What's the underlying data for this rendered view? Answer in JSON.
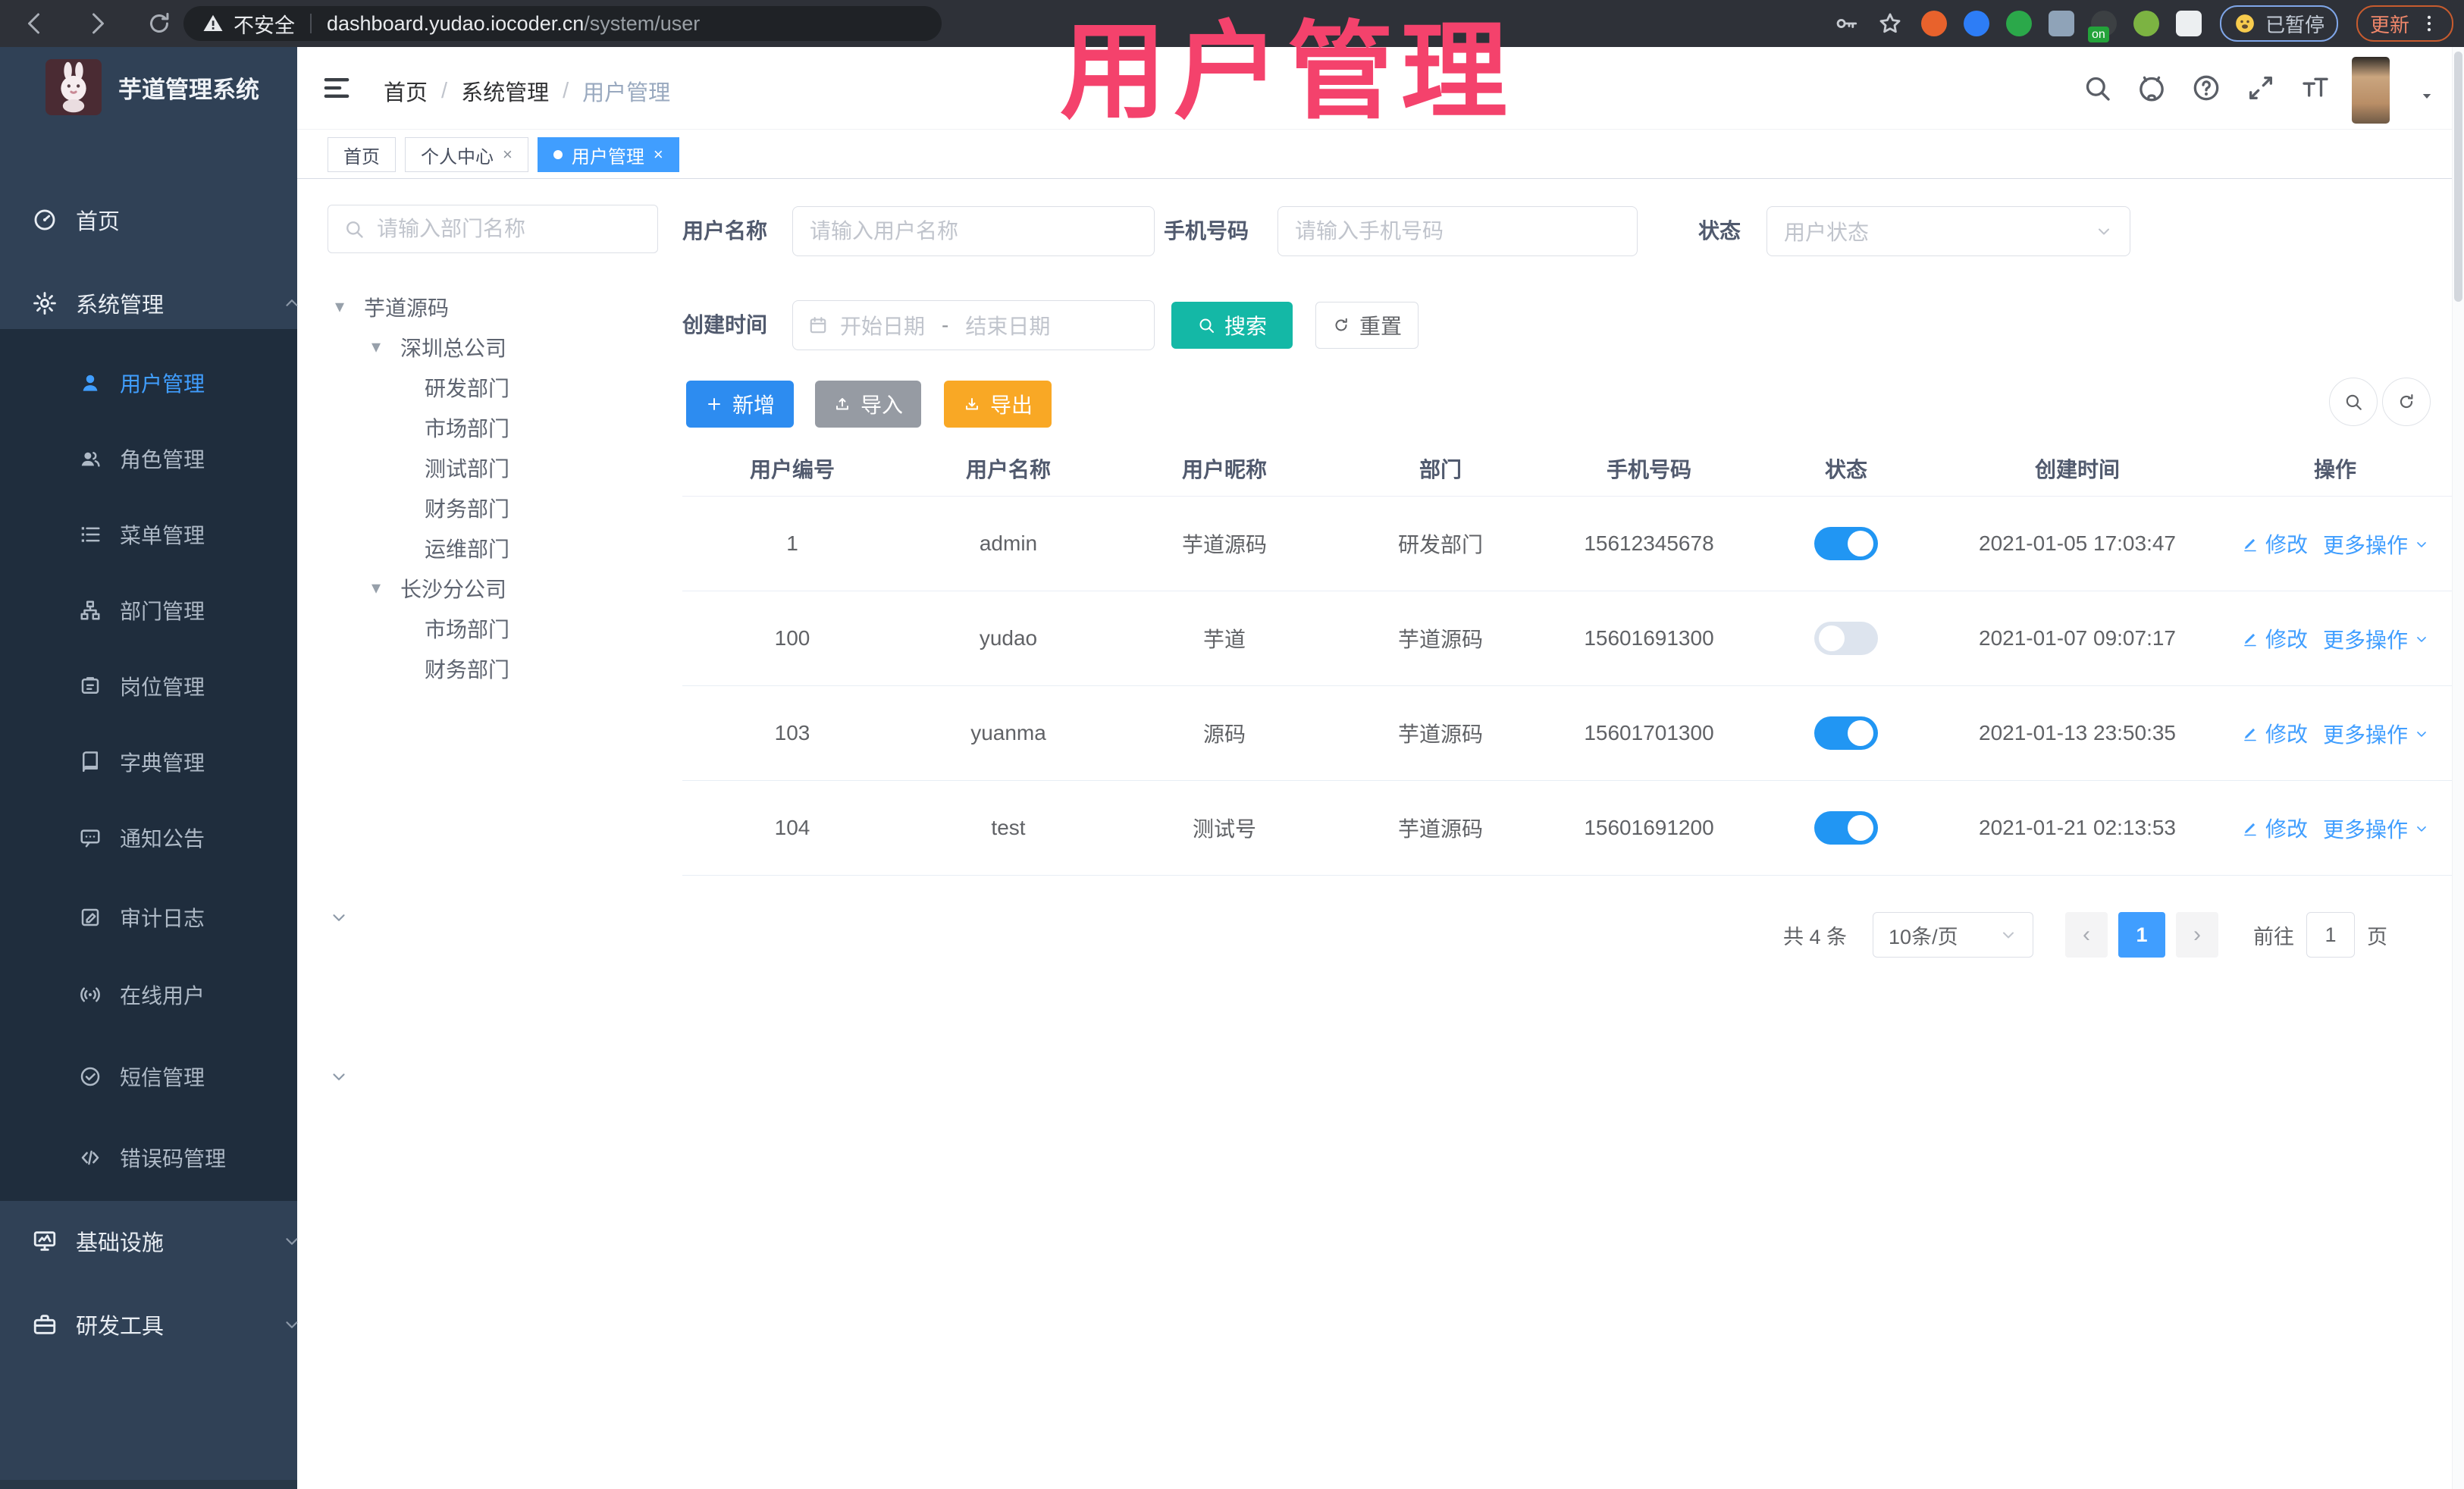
{
  "browser": {
    "security_label": "不安全",
    "url_host": "dashboard.yudao.iocoder.cn",
    "url_path": "/system/user",
    "paused_badge": "已暂停",
    "update_label": "更新",
    "extensions": [
      {
        "name": "extension-ubuntu-icon",
        "color": "#E8622C"
      },
      {
        "name": "extension-gem-icon",
        "color": "#2D7DF6"
      },
      {
        "name": "extension-green-circle-icon",
        "color": "#2BA84A"
      },
      {
        "name": "extension-grid-icon",
        "color": "#8FA3B8"
      },
      {
        "name": "extension-list-icon",
        "color": "#3C4043",
        "badge": "on"
      },
      {
        "name": "extension-key-green-icon",
        "color": "#7CB342"
      },
      {
        "name": "extension-puzzle-icon",
        "color": "#ECEFF1"
      }
    ]
  },
  "overlay_title": "用户管理",
  "sidebar": {
    "app_title": "芋道管理系统",
    "menu": [
      {
        "name": "home",
        "label": "首页",
        "icon": "dashboard-icon",
        "level": 1
      },
      {
        "name": "system-management",
        "label": "系统管理",
        "icon": "gear-icon",
        "level": 1,
        "chevron": "up"
      },
      {
        "name": "user-management",
        "label": "用户管理",
        "icon": "user-icon",
        "level": 2,
        "active": true
      },
      {
        "name": "role-management",
        "label": "角色管理",
        "icon": "users-icon",
        "level": 2
      },
      {
        "name": "menu-management",
        "label": "菜单管理",
        "icon": "menu-list-icon",
        "level": 2
      },
      {
        "name": "department-management",
        "label": "部门管理",
        "icon": "org-tree-icon",
        "level": 2
      },
      {
        "name": "post-management",
        "label": "岗位管理",
        "icon": "badge-icon",
        "level": 2
      },
      {
        "name": "dict-management",
        "label": "字典管理",
        "icon": "dictionary-icon",
        "level": 2
      },
      {
        "name": "notice-announcement",
        "label": "通知公告",
        "icon": "announcement-icon",
        "level": 2
      },
      {
        "name": "audit-log",
        "label": "审计日志",
        "icon": "audit-log-icon",
        "level": 2,
        "chevron": "down"
      },
      {
        "name": "online-users",
        "label": "在线用户",
        "icon": "online-user-icon",
        "level": 2
      },
      {
        "name": "sms-management",
        "label": "短信管理",
        "icon": "check-circle-icon",
        "level": 2,
        "chevron": "down"
      },
      {
        "name": "error-code-management",
        "label": "错误码管理",
        "icon": "code-icon",
        "level": 2
      },
      {
        "name": "infrastructure",
        "label": "基础设施",
        "icon": "monitor-icon",
        "level": 1,
        "chevron": "down"
      },
      {
        "name": "dev-tools",
        "label": "研发工具",
        "icon": "briefcase-icon",
        "level": 1,
        "chevron": "down"
      }
    ]
  },
  "header": {
    "breadcrumb": [
      "首页",
      "系统管理",
      "用户管理"
    ]
  },
  "tabs": [
    {
      "name": "tab-home",
      "label": "首页"
    },
    {
      "name": "tab-profile",
      "label": "个人中心",
      "closable": true
    },
    {
      "name": "tab-user-management",
      "label": "用户管理",
      "closable": true,
      "active": true
    }
  ],
  "dept_panel": {
    "search_placeholder": "请输入部门名称",
    "tree": [
      {
        "label": "芋道源码",
        "depth": 0,
        "expandable": true
      },
      {
        "label": "深圳总公司",
        "depth": 1,
        "expandable": true
      },
      {
        "label": "研发部门",
        "depth": 2
      },
      {
        "label": "市场部门",
        "depth": 2
      },
      {
        "label": "测试部门",
        "depth": 2
      },
      {
        "label": "财务部门",
        "depth": 2
      },
      {
        "label": "运维部门",
        "depth": 2
      },
      {
        "label": "长沙分公司",
        "depth": 1,
        "expandable": true
      },
      {
        "label": "市场部门",
        "depth": 2
      },
      {
        "label": "财务部门",
        "depth": 2
      }
    ]
  },
  "filters": {
    "username_label": "用户名称",
    "username_placeholder": "请输入用户名称",
    "mobile_label": "手机号码",
    "mobile_placeholder": "请输入手机号码",
    "status_label": "状态",
    "status_placeholder": "用户状态",
    "created_label": "创建时间",
    "date_start_placeholder": "开始日期",
    "date_separator": "-",
    "date_end_placeholder": "结束日期",
    "search_label": "搜索",
    "reset_label": "重置"
  },
  "toolbar": {
    "add_label": "新增",
    "import_label": "导入",
    "export_label": "导出"
  },
  "table": {
    "columns": [
      "用户编号",
      "用户名称",
      "用户昵称",
      "部门",
      "手机号码",
      "状态",
      "创建时间",
      "操作"
    ],
    "row_actions": {
      "edit": "修改",
      "more": "更多操作"
    },
    "rows": [
      {
        "id": "1",
        "username": "admin",
        "nickname": "芋道源码",
        "dept": "研发部门",
        "mobile": "15612345678",
        "status_on": true,
        "created": "2021-01-05 17:03:47"
      },
      {
        "id": "100",
        "username": "yudao",
        "nickname": "芋道",
        "dept": "芋道源码",
        "mobile": "15601691300",
        "status_on": false,
        "created": "2021-01-07 09:07:17"
      },
      {
        "id": "103",
        "username": "yuanma",
        "nickname": "源码",
        "dept": "芋道源码",
        "mobile": "15601701300",
        "status_on": true,
        "created": "2021-01-13 23:50:35"
      },
      {
        "id": "104",
        "username": "test",
        "nickname": "测试号",
        "dept": "芋道源码",
        "mobile": "15601691200",
        "status_on": true,
        "created": "2021-01-21 02:13:53"
      }
    ]
  },
  "pagination": {
    "total_text": "共 4 条",
    "page_size": "10条/页",
    "current_page": "1",
    "goto_label": "前往",
    "goto_value": "1",
    "page_unit": "页"
  },
  "colors": {
    "accent_blue": "#409EFF",
    "teal_search": "#14B8A6",
    "orange_export": "#F9A825",
    "sidebar_bg": "#304156",
    "submenu_bg": "#1F2D3D",
    "overlay_pink": "#F4426C",
    "toggle_on": "#2196F3"
  }
}
